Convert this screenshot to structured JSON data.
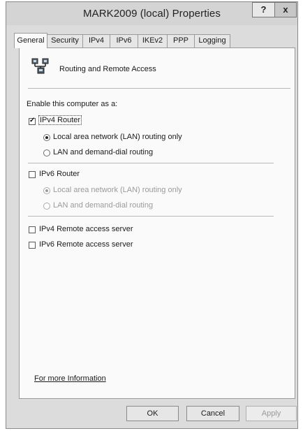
{
  "window": {
    "title": "MARK2009 (local) Properties",
    "help_label": "?",
    "close_label": "x"
  },
  "tabs": [
    {
      "label": "General",
      "active": true
    },
    {
      "label": "Security"
    },
    {
      "label": "IPv4"
    },
    {
      "label": "IPv6"
    },
    {
      "label": "IKEv2"
    },
    {
      "label": "PPP"
    },
    {
      "label": "Logging"
    }
  ],
  "header": {
    "icon": "routing-servers-icon",
    "text": "Routing and Remote Access"
  },
  "enable_label": "Enable this computer as a:",
  "ipv4_router": {
    "label": "IPv4 Router",
    "checked": true,
    "options": [
      {
        "label": "Local area network (LAN) routing only",
        "selected": true
      },
      {
        "label": "LAN and demand-dial routing",
        "selected": false
      }
    ]
  },
  "ipv6_router": {
    "label": "IPv6 Router",
    "checked": false,
    "options": [
      {
        "label": "Local area network (LAN) routing only",
        "selected": true,
        "disabled": true
      },
      {
        "label": "LAN and demand-dial routing",
        "selected": false,
        "disabled": true
      }
    ]
  },
  "ipv4_remote": {
    "label": "IPv4 Remote access server",
    "checked": false
  },
  "ipv6_remote": {
    "label": "IPv6 Remote access server",
    "checked": false
  },
  "more_info_link": "For more Information",
  "buttons": {
    "ok": "OK",
    "cancel": "Cancel",
    "apply": "Apply"
  }
}
